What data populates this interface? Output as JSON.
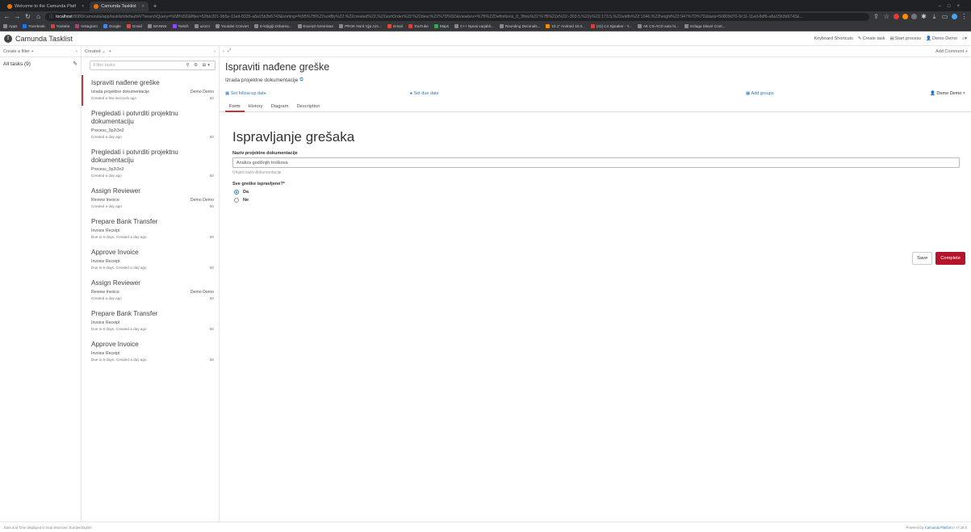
{
  "browser": {
    "tabs": [
      {
        "title": "Welcome to the Camunda Platf",
        "active": false
      },
      {
        "title": "Camunda Tasklist",
        "active": true
      }
    ],
    "url_host": "localhost",
    "url_rest": ":8080/camunda/app/tasklist/default/#/?searchQuery=%5B%5D&filter=52fdc201-9b5e-11ed-8335-a8a15b3b6743&sorting=%5B%7B%22sortBy%22:%22created%22,%22sortOrder%22:%22desc%22%7D%5D&viewbox=%7B%22Definitions_0_3fntu%22:%7B%22x%22:-303.5,%22y%22:173.5,%22width%22:1046,%22height%22:947%7D%7D&task=50809d70-9c11-11ed-8df6-a8a15b3b6743&...",
    "bookmarks": [
      "Apps",
      "Facebook",
      "Youtube",
      "Instagram",
      "Google",
      "Gmail",
      "WANNE",
      "Twitch",
      "uzorci",
      "Youtube Convert",
      "E-knjigiji Dzbarna...",
      "Excerpt Generator",
      "PROK Nord Vjjo Azc...",
      "Gmail",
      "YouTube",
      "Maps",
      "C++ Npoai varjabli...",
      "Rounding Decimals...",
      "10.1\" Android 10.0...",
      "(41) C4 Speaker - Y...",
      "AK CS-ACD auto hi...",
      "Izzlaga Slaver Cont..."
    ]
  },
  "app": {
    "name": "Camunda Tasklist",
    "logo_glyph": "!",
    "header_links": {
      "shortcuts": "Keyboard Shortcuts",
      "create_task": "Create task",
      "start_process": "Start process",
      "user": "Demo Demo"
    }
  },
  "toolbar": {
    "create_filter": "Create a filter +",
    "sort": "Created",
    "add_comment": "Add Comment +"
  },
  "filters": [
    {
      "label": "All tasks (9)"
    }
  ],
  "search": {
    "placeholder": "Filter tasks"
  },
  "tasks": [
    {
      "name": "Ispraviti nađene greške",
      "process": "Izrada projektne dokumentacije",
      "assignee": "Demo Demo",
      "meta": "Created a few seconds ago",
      "priority": "50",
      "selected": true
    },
    {
      "name": "Pregledati i potvrditi projektnu dokumentaciju",
      "process": "Process_0p2t3n3",
      "assignee": "",
      "meta": "Created a day ago",
      "priority": "50",
      "selected": false
    },
    {
      "name": "Pregledati i potvrditi projektnu dokumentaciju",
      "process": "Process_0p2t3n3",
      "assignee": "",
      "meta": "Created a day ago",
      "priority": "50",
      "selected": false
    },
    {
      "name": "Assign Reviewer",
      "process": "Review Invoice",
      "assignee": "Demo Demo",
      "meta": "Created a day ago",
      "priority": "50",
      "selected": false
    },
    {
      "name": "Prepare Bank Transfer",
      "process": "Invoice Receipt",
      "assignee": "",
      "meta": "Due in 6 days, Created a day ago",
      "priority": "50",
      "selected": false
    },
    {
      "name": "Approve Invoice",
      "process": "Invoice Receipt",
      "assignee": "",
      "meta": "Due in 6 days, Created a day ago",
      "priority": "50",
      "selected": false
    },
    {
      "name": "Assign Reviewer",
      "process": "Review Invoice",
      "assignee": "Demo Demo",
      "meta": "Created a day ago",
      "priority": "50",
      "selected": false
    },
    {
      "name": "Prepare Bank Transfer",
      "process": "Invoice Receipt",
      "assignee": "",
      "meta": "Due in 6 days, Created a day ago",
      "priority": "50",
      "selected": false
    },
    {
      "name": "Approve Invoice",
      "process": "Invoice Receipt",
      "assignee": "",
      "meta": "Due in 6 days, Created a day ago",
      "priority": "50",
      "selected": false
    }
  ],
  "detail": {
    "title": "Ispraviti nađene greške",
    "process_link": "Izrada projektne dokumentacije",
    "actions": {
      "follow_up": "Set follow-up date",
      "due": "Set due date",
      "groups": "Add groups",
      "assignee": "Demo Demo"
    },
    "tabs": [
      "Form",
      "History",
      "Diagram",
      "Description"
    ],
    "active_tab": "Form"
  },
  "form": {
    "title": "Ispravljanje grešaka",
    "field1_label": "Naziv projektne dokumentacije",
    "field1_value": "Analiza godišnjih troškova",
    "field1_help": "Unijeti naziv dokumentacije",
    "field2_label": "Sve greške ispravljene?*",
    "options": [
      {
        "label": "Da",
        "checked": true
      },
      {
        "label": "Ne",
        "checked": false
      }
    ],
    "save": "Save",
    "complete": "Complete"
  },
  "footer": {
    "left": "Date and Time displayed in local timezone: Europe/Zagreb",
    "right_prefix": "Powered by",
    "right_brand": "Camunda Platform",
    "right_version": "/ v7.18.0"
  },
  "colors": {
    "accent": "#b5152b",
    "link": "#2a7ac0"
  }
}
